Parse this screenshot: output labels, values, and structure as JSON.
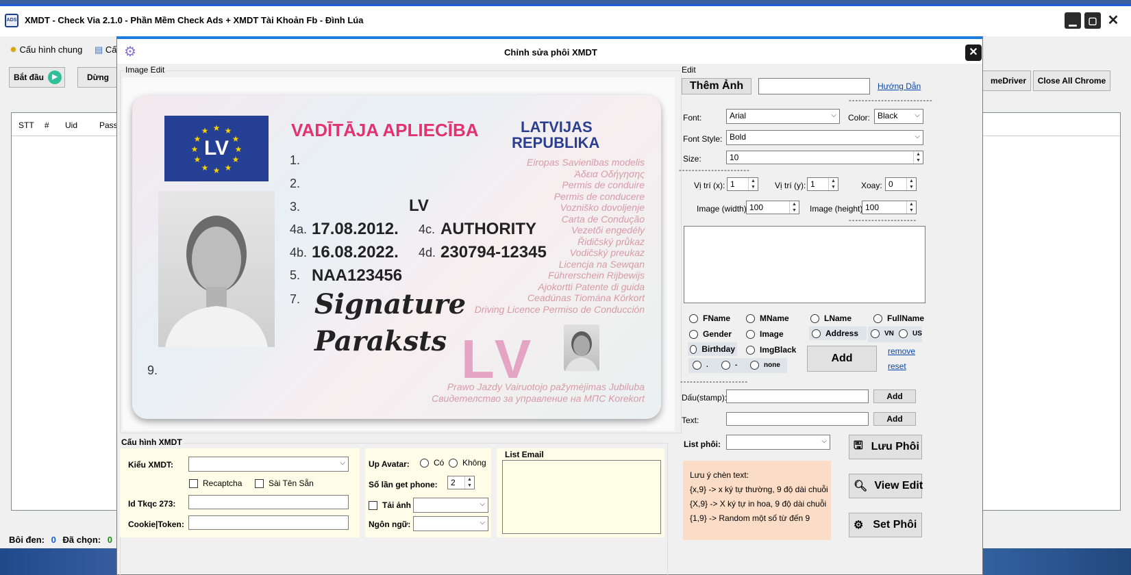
{
  "app": {
    "title": "XMDT - Check Via 2.1.0 - Phần Mềm Check Ads + XMDT Tài Khoản Fb - Đình Lúa",
    "icon": "app-logo-icon",
    "window_controls": [
      "minimize",
      "maximize",
      "close"
    ]
  },
  "menu": {
    "items": [
      {
        "label": "Cấu hình chung",
        "icon": "sun-gear-icon"
      },
      {
        "label": "Cấ",
        "icon": "window-icon"
      }
    ]
  },
  "toolbar": {
    "start_label": "Bắt đầu",
    "stop_label": "Dừng",
    "chromedriver_label": "meDriver",
    "close_chrome_label": "Close All Chrome"
  },
  "grid": {
    "columns": [
      "STT",
      "#",
      "Uid",
      "Pass_"
    ]
  },
  "status": {
    "boi_den_label": "Bôi đen:",
    "boi_den_value": "0",
    "da_chon_label": "Đã chọn:",
    "da_chon_value": "0"
  },
  "dialog": {
    "title": "Chỉnh sửa phôi XMDT",
    "image_edit_label": "Image Edit",
    "edit_label": "Edit",
    "card": {
      "heading_pink": "VADĪTĀJA APLIECĪBA",
      "heading_blue_1": "LATVIJAS",
      "heading_blue_2": "REPUBLIKA",
      "flag_text": "LV",
      "row_numbers": [
        "1.",
        "2.",
        "3.",
        "4a.",
        "4b.",
        "5.",
        "7.",
        "9.",
        "4c.",
        "4d."
      ],
      "field_3": "LV",
      "field_4a": "17.08.2012.",
      "field_4b": "16.08.2022.",
      "field_4c": "AUTHORITY",
      "field_4d": "230794-12345",
      "field_5": "NAA123456",
      "signature_1": "Signature",
      "signature_2": "Paraksts",
      "big_lv": "LV",
      "faint_lines": [
        "Eiropas Savienības modelis",
        "Άδεια Οδήγησης",
        "Permis de conduire",
        "Permis de conducere",
        "Vozniško dovoljenje",
        "Carta de Condução",
        "Vezetői engedély",
        "Řidičský průkaz",
        "Vodičský preukaz",
        "Licencja na Sewqan",
        "Führerschein Rijbewijs",
        "Ajokortti Patente di guida",
        "Ceadúnas Tiomána Körkort",
        "Driving Licence Permiso de Conducción",
        "Prawo Jazdy Vairuotojo pažymėjimas Jubiluba",
        "Свидетелство за управление на МПС Korekort"
      ]
    },
    "them_anh_label": "Thêm Ảnh",
    "them_anh_value": "",
    "huong_dan_label": "Hướng Dẫn",
    "font_label": "Font:",
    "font_value": "Arial",
    "color_label": "Color:",
    "color_value": "Black",
    "font_style_label": "Font Style:",
    "font_style_value": "Bold",
    "size_label": "Size:",
    "size_value": "10",
    "vitri_x_label": "Vị trí (x):",
    "vitri_x_value": "1",
    "vitri_y_label": "Vị trí (y):",
    "vitri_y_value": "1",
    "xoay_label": "Xoay:",
    "xoay_value": "0",
    "img_width_label": "Image (width):",
    "img_width_value": "100",
    "img_height_label": "Image (height):",
    "img_height_value": "100",
    "radios": {
      "fname": "FName",
      "mname": "MName",
      "lname": "LName",
      "fullname": "FullName",
      "gender": "Gender",
      "image": "Image",
      "address": "Address",
      "vn": "VN",
      "us": "US",
      "birthday": "Birthday",
      "imgblack": "ImgBlack",
      "dot": ".",
      "dash": "-",
      "none": "none"
    },
    "add_label": "Add",
    "remove_label": "remove",
    "reset_label": "reset",
    "stamp_label": "Dấu(stamp):",
    "stamp_value": "",
    "stamp_add": "Add",
    "text_label": "Text:",
    "text_value": "",
    "text_add": "Add",
    "list_phoi_label": "List phôi:",
    "list_phoi_value": "",
    "luu_phoi_label": "Lưu Phôi",
    "view_edit_label": "View Edit",
    "set_phoi_label": "Set Phôi",
    "note": {
      "title": "Lưu ý chèn text:",
      "line1": "{x,9} -> x ký tự thường, 9 độ dài chuỗi",
      "line2": "{X,9} -> X ký tự in hoa, 9 độ dài chuỗi",
      "line3": "{1,9} -> Random một số từ  đến 9"
    },
    "config": {
      "group_label": "Cấu hình XMDT",
      "kieu_xmdt_label": "Kiểu XMDT:",
      "kieu_xmdt_value": "",
      "recaptcha_label": "Recaptcha",
      "sai_ten_san_label": "Sài Tên Sẵn",
      "id_tkqc_label": "Id Tkqc 273:",
      "id_tkqc_value": "",
      "cookie_label": "Cookie|Token:",
      "cookie_value": "",
      "up_avatar_label": "Up Avatar:",
      "co_label": "Có",
      "khong_label": "Không",
      "so_lan_label": "Số lần get phone:",
      "so_lan_value": "2",
      "tai_anh_label": "Tải ảnh",
      "tai_anh_value": "",
      "ngon_ngu_label": "Ngôn ngữ:",
      "ngon_ngu_value": "",
      "list_email_label": "List Email",
      "list_email_value": ""
    },
    "colors": {
      "accent": "#1e7be0",
      "note_bg": "#fbdcc6",
      "config_bg": "#fffde7",
      "card_pink": "#e0336f",
      "card_blue": "#2a3f8f"
    }
  }
}
